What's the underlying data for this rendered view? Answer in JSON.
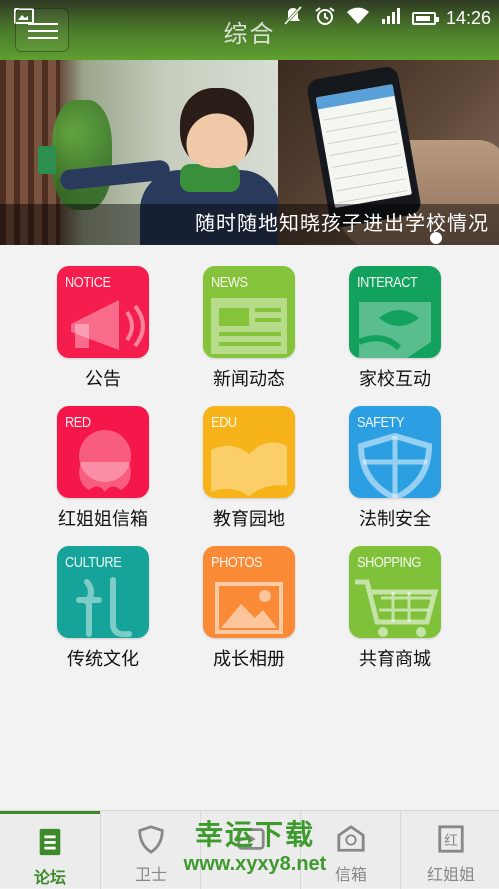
{
  "status_bar": {
    "icons": [
      "image-notification-icon",
      "mute-icon",
      "alarm-icon",
      "wifi-icon",
      "signal-icon",
      "battery-icon"
    ],
    "time": "14:26"
  },
  "header": {
    "title": "综合",
    "menu_icon": "hamburger-menu-icon",
    "color": "#5fa030"
  },
  "banner": {
    "caption": "随时随地知晓孩子进出学校情况"
  },
  "grid": {
    "items": [
      {
        "label": "公告",
        "tag": "NOTICE",
        "color": "#f51d4e",
        "icon": "megaphone-icon"
      },
      {
        "label": "新闻动态",
        "tag": "NEWS",
        "color": "#85c33b",
        "icon": "newspaper-icon"
      },
      {
        "label": "家校互动",
        "tag": "INTERACT",
        "color": "#13a15e",
        "icon": "chat-interact-icon"
      },
      {
        "label": "红姐姐信箱",
        "tag": "RED",
        "color": "#f5174a",
        "icon": "girl-silhouette-icon"
      },
      {
        "label": "教育园地",
        "tag": "EDU",
        "color": "#f7b41a",
        "icon": "open-book-icon"
      },
      {
        "label": "法制安全",
        "tag": "SAFETY",
        "color": "#2b9fe2",
        "icon": "shield-icon"
      },
      {
        "label": "传统文化",
        "tag": "CULTURE",
        "color": "#15a39a",
        "icon": "calligraphy-li-icon"
      },
      {
        "label": "成长相册",
        "tag": "PHOTOS",
        "color": "#fb8a37",
        "icon": "photo-icon"
      },
      {
        "label": "共育商城",
        "tag": "SHOPPING",
        "color": "#7fc23a",
        "icon": "shopping-cart-icon"
      }
    ]
  },
  "bottom_nav": {
    "items": [
      {
        "label": "论坛",
        "icon": "forum-document-icon",
        "active": true
      },
      {
        "label": "卫士",
        "icon": "guard-shield-icon",
        "active": false
      },
      {
        "label": "",
        "icon": "video-icon",
        "active": false
      },
      {
        "label": "信箱",
        "icon": "mailbox-icon",
        "active": false
      },
      {
        "label": "红姐姐",
        "icon": "red-sister-icon",
        "active": false
      }
    ],
    "active_color": "#3d8a2a"
  },
  "watermark": {
    "title": "幸运下载",
    "url": "www.xyxy8.net"
  }
}
